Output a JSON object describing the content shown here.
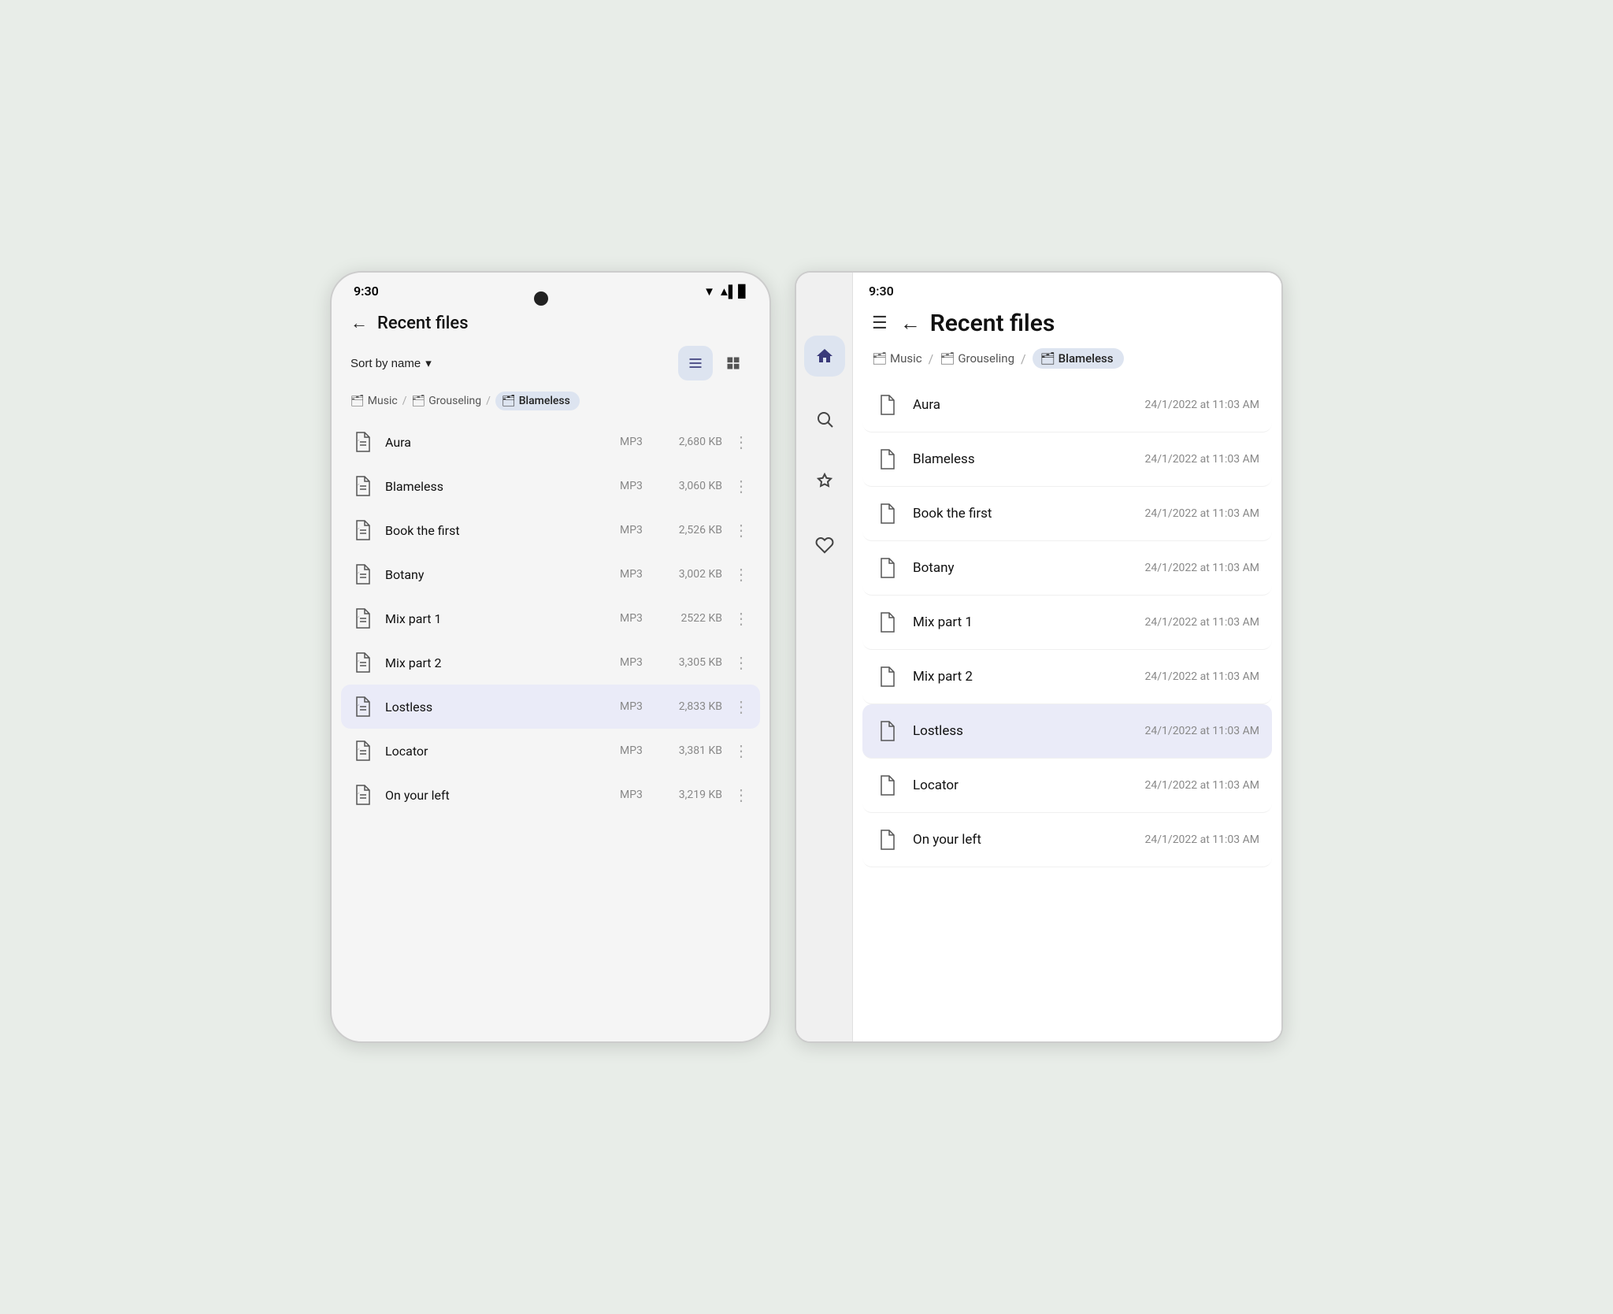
{
  "leftPhone": {
    "statusBar": {
      "time": "9:30",
      "wifi": "▼",
      "signal": "▲▌",
      "battery": "▊"
    },
    "header": {
      "backLabel": "←",
      "title": "Recent files"
    },
    "sortBar": {
      "sortLabel": "Sort by name",
      "chevron": "▾",
      "listViewActive": true,
      "gridViewActive": false
    },
    "breadcrumb": [
      {
        "label": "Music",
        "icon": "🗂",
        "active": false
      },
      {
        "sep": "/"
      },
      {
        "label": "Grouseling",
        "icon": "🗂",
        "active": false
      },
      {
        "sep": "/"
      },
      {
        "label": "Blameless",
        "icon": "🗂",
        "active": true
      }
    ],
    "files": [
      {
        "name": "Aura",
        "type": "MP3",
        "size": "2,680 KB",
        "selected": false
      },
      {
        "name": "Blameless",
        "type": "MP3",
        "size": "3,060 KB",
        "selected": false
      },
      {
        "name": "Book the first",
        "type": "MP3",
        "size": "2,526 KB",
        "selected": false
      },
      {
        "name": "Botany",
        "type": "MP3",
        "size": "3,002 KB",
        "selected": false
      },
      {
        "name": "Mix part 1",
        "type": "MP3",
        "size": "2522 KB",
        "selected": false
      },
      {
        "name": "Mix part 2",
        "type": "MP3",
        "size": "3,305 KB",
        "selected": false
      },
      {
        "name": "Lostless",
        "type": "MP3",
        "size": "2,833 KB",
        "selected": true
      },
      {
        "name": "Locator",
        "type": "MP3",
        "size": "3,381 KB",
        "selected": false
      },
      {
        "name": "On your left",
        "type": "MP3",
        "size": "3,219 KB",
        "selected": false
      }
    ]
  },
  "rightTablet": {
    "statusBar": {
      "time": "9:30"
    },
    "header": {
      "menuIcon": "☰",
      "backLabel": "←",
      "title": "Recent files"
    },
    "breadcrumb": [
      {
        "label": "Music",
        "icon": "🗂",
        "active": false
      },
      {
        "sep": "/"
      },
      {
        "label": "Grouseling",
        "icon": "🗂",
        "active": false
      },
      {
        "sep": "/"
      },
      {
        "label": "Blameless",
        "icon": "🗂",
        "active": true
      }
    ],
    "nav": [
      {
        "icon": "🏠",
        "active": true,
        "name": "home"
      },
      {
        "icon": "🔍",
        "active": false,
        "name": "search"
      },
      {
        "icon": "✅",
        "active": false,
        "name": "verified"
      },
      {
        "icon": "♡",
        "active": false,
        "name": "favorites"
      }
    ],
    "files": [
      {
        "name": "Aura",
        "date": "24/1/2022 at 11:03 AM",
        "selected": false
      },
      {
        "name": "Blameless",
        "date": "24/1/2022 at 11:03 AM",
        "selected": false
      },
      {
        "name": "Book the first",
        "date": "24/1/2022 at 11:03 AM",
        "selected": false
      },
      {
        "name": "Botany",
        "date": "24/1/2022 at 11:03 AM",
        "selected": false
      },
      {
        "name": "Mix part 1",
        "date": "24/1/2022 at 11:03 AM",
        "selected": false
      },
      {
        "name": "Mix part 2",
        "date": "24/1/2022 at 11:03 AM",
        "selected": false
      },
      {
        "name": "Lostless",
        "date": "24/1/2022 at 11:03 AM",
        "selected": true
      },
      {
        "name": "Locator",
        "date": "24/1/2022 at 11:03 AM",
        "selected": false
      },
      {
        "name": "On your left",
        "date": "24/1/2022 at 11:03 AM",
        "selected": false
      }
    ]
  }
}
